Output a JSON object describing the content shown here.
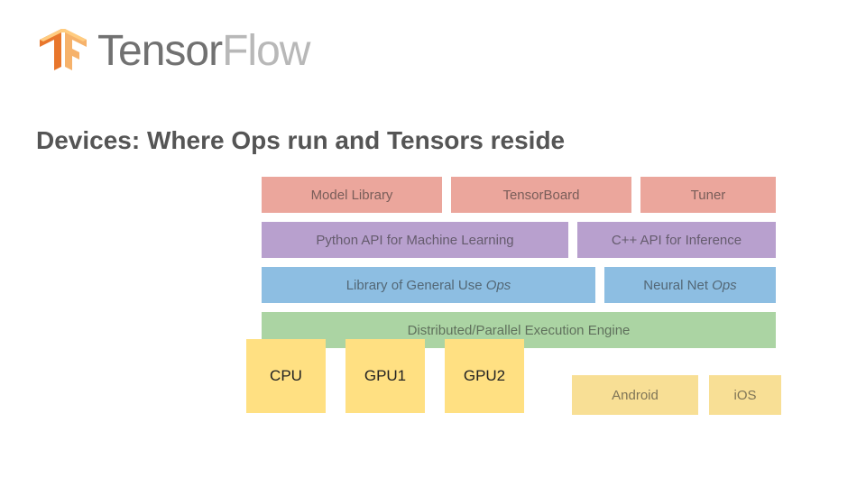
{
  "logo": {
    "word1": "Tensor",
    "word2": "Flow"
  },
  "title": "Devices: Where Ops run and Tensors reside",
  "rows": {
    "top": [
      "Model Library",
      "TensorBoard",
      "Tuner"
    ],
    "api": [
      "Python API for Machine Learning",
      "C++ API for Inference"
    ],
    "ops_gen_prefix": "Library of General Use ",
    "ops_gen_em": "Ops",
    "ops_nn_prefix": "Neural Net ",
    "ops_nn_em": "Ops",
    "engine": "Distributed/Parallel Execution Engine"
  },
  "devices": [
    "CPU",
    "GPU1",
    "GPU2"
  ],
  "platforms": [
    "Android",
    "iOS"
  ]
}
